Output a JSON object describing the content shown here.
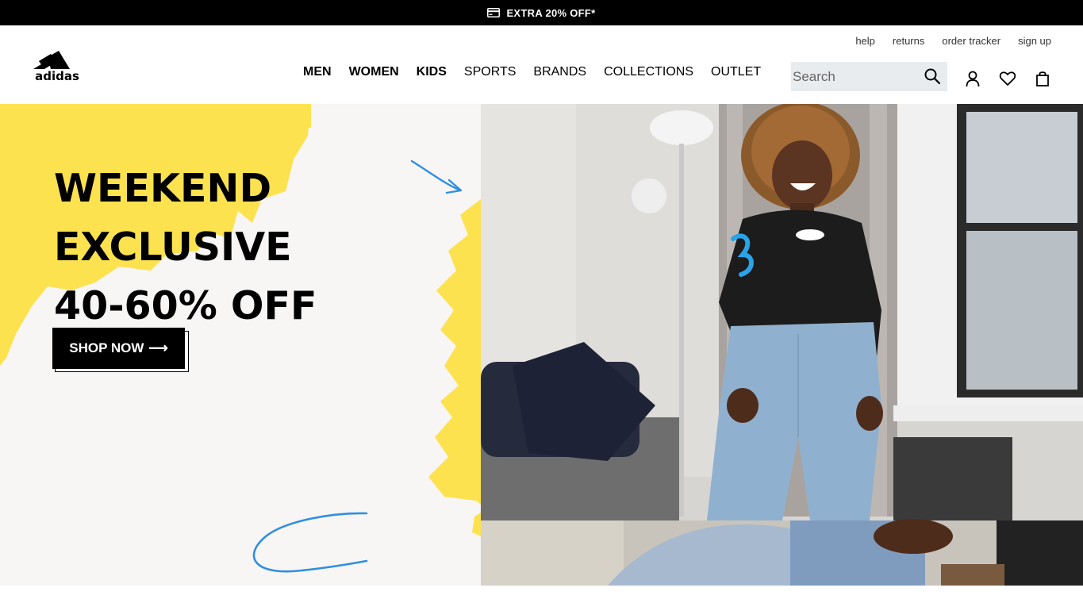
{
  "promo": {
    "text": "EXTRA 20% OFF*",
    "icon": "card-icon"
  },
  "header": {
    "logo_alt": "adidas",
    "utility_links": [
      "help",
      "returns",
      "order tracker",
      "sign up"
    ],
    "nav": [
      "MEN",
      "WOMEN",
      "KIDS",
      "SPORTS",
      "BRANDS",
      "COLLECTIONS",
      "OUTLET"
    ],
    "search": {
      "placeholder": "Search",
      "value": ""
    },
    "icons": [
      "search-icon",
      "account-icon",
      "wishlist-heart-icon",
      "shopping-bag-icon"
    ]
  },
  "hero": {
    "title_line1": "WEEKEND",
    "title_line2": "EXCLUSIVE",
    "title_line3": "40-60% OFF",
    "cta_label": "SHOP NOW",
    "cta_arrow": "⟶"
  },
  "colors": {
    "promo_bg": "#000000",
    "accent_yellow": "#fde24f",
    "accent_blue": "#2f8fe0",
    "search_bg": "#e9ecef",
    "hero_bg": "#f8f5f5"
  }
}
